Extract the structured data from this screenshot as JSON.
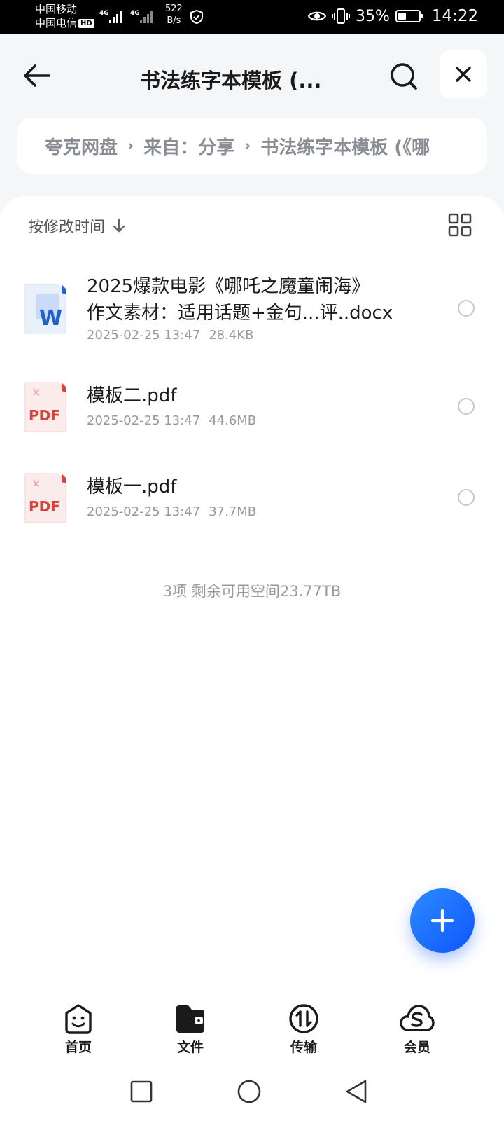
{
  "status_bar": {
    "carrier1": "中国移动",
    "carrier2": "中国电信",
    "hd": "HD",
    "net_type1": "4G",
    "net_type2": "4G",
    "speed_value": "522",
    "speed_unit": "B/s",
    "battery": "35%",
    "time": "14:22"
  },
  "header": {
    "title": "书法练字本模板 (..."
  },
  "breadcrumb": {
    "items": [
      "夸克网盘",
      "来自：分享",
      "书法练字本模板 (《哪"
    ]
  },
  "sort": {
    "label": "按修改时间"
  },
  "files": [
    {
      "name_line1": "2025爆款电影《哪吒之魔童闹海》",
      "name_line2": "作文素材：适用话题+金句...评..docx",
      "date": "2025-02-25 13:47",
      "size": "28.4KB",
      "type": "docx"
    },
    {
      "name_line1": "模板二.pdf",
      "date": "2025-02-25 13:47",
      "size": "44.6MB",
      "type": "pdf"
    },
    {
      "name_line1": "模板一.pdf",
      "date": "2025-02-25 13:47",
      "size": "37.7MB",
      "type": "pdf"
    }
  ],
  "file_type_labels": {
    "word": "W",
    "pdf": "PDF"
  },
  "summary": "3项 剩余可用空间23.77TB",
  "bottom_nav": [
    {
      "label": "首页",
      "icon": "home-smile-icon"
    },
    {
      "label": "文件",
      "icon": "folder-icon"
    },
    {
      "label": "传输",
      "icon": "transfer-icon"
    },
    {
      "label": "会员",
      "icon": "vip-cloud-icon"
    }
  ],
  "colors": {
    "accent": "#1467ff",
    "pdf_red": "#d9413a",
    "word_blue": "#1e62c9"
  }
}
